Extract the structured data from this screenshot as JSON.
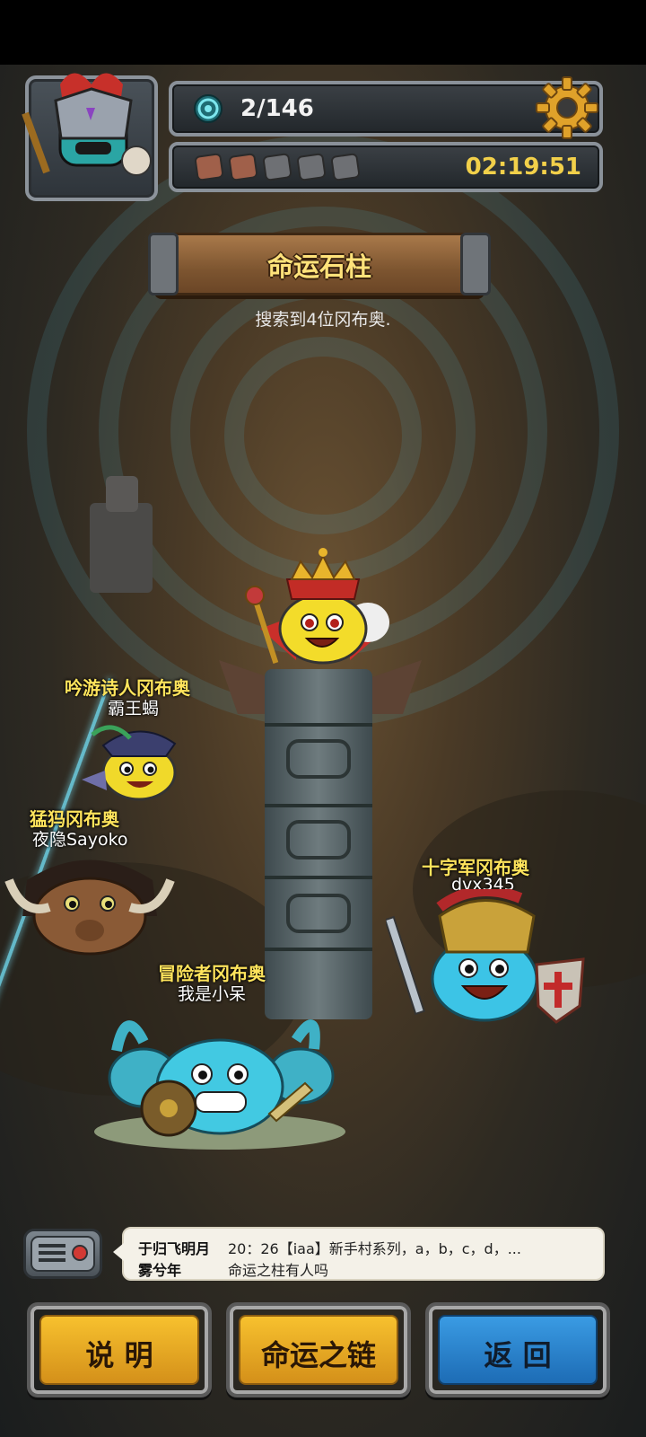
{
  "status": {
    "count_icon": "ring-icon",
    "count": "2/146",
    "timer": "02:19:51",
    "chips": [
      "filled",
      "filled",
      "empty",
      "empty",
      "empty"
    ],
    "settings_icon": "gear-icon"
  },
  "header": {
    "title": "命运石柱",
    "subtitle": "搜索到4位冈布奥."
  },
  "characters": {
    "bard": {
      "title": "吟游诗人冈布奥",
      "name": "霸王蝎"
    },
    "mammoth": {
      "title": "猛犸冈布奥",
      "name": "夜隐Sayoko"
    },
    "crusader": {
      "title": "十字军冈布奥",
      "name": "dvx345"
    },
    "adventurer": {
      "title": "冒险者冈布奥",
      "name": "我是小呆"
    }
  },
  "chat": {
    "icon": "radio-icon",
    "messages": [
      {
        "user": "于归飞明月",
        "text": "20：26【iaa】新手村系列，a，b，c，d，..."
      },
      {
        "user": "雾兮年",
        "text": "命运之柱有人吗"
      }
    ]
  },
  "buttons": {
    "help": "说 明",
    "chain": "命运之链",
    "back": "返 回"
  },
  "colors": {
    "accent_yellow": "#f7c12e",
    "accent_blue": "#3a9be3",
    "timer": "#f2d04a",
    "character_title": "#ffe45c"
  }
}
